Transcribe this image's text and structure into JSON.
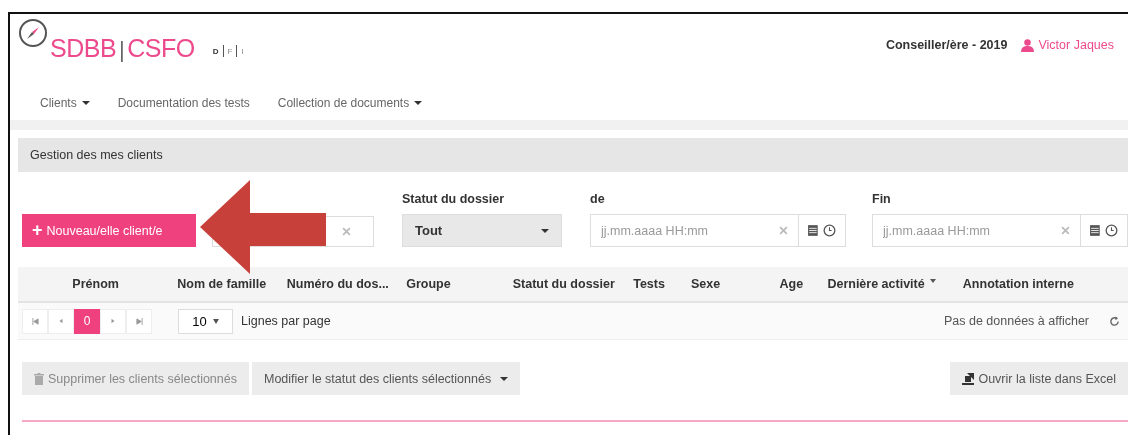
{
  "header": {
    "logo_left": "SDBB",
    "logo_separator": "|",
    "logo_right": "CSFO",
    "languages": [
      {
        "label": "D",
        "selected": true
      },
      {
        "label": "F",
        "selected": false
      },
      {
        "label": "I",
        "selected": false
      }
    ],
    "role": "Conseiller/ère - 2019",
    "user": "Victor Jaques"
  },
  "nav": [
    {
      "label": "Clients",
      "dropdown": true
    },
    {
      "label": "Documentation des tests",
      "dropdown": false
    },
    {
      "label": "Collection de documents",
      "dropdown": true
    }
  ],
  "section_title": "Gestion des mes clients",
  "new_button": {
    "icon": "+",
    "label": "Nouveau/elle client/e"
  },
  "filters": {
    "status_label": "Statut du dossier",
    "status_value": "Tout",
    "from_label": "de",
    "from_placeholder": "jj.mm.aaaa HH:mm",
    "to_label": "Fin",
    "to_placeholder": "jj.mm.aaaa HH:mm"
  },
  "table": {
    "columns": [
      {
        "label": "Prénom",
        "sorted": false
      },
      {
        "label": "Nom de famille",
        "sorted": false
      },
      {
        "label": "Numéro du dos...",
        "sorted": false
      },
      {
        "label": "Groupe",
        "sorted": false
      },
      {
        "label": "Statut du dossier",
        "sorted": false
      },
      {
        "label": "Tests",
        "sorted": false
      },
      {
        "label": "Sexe",
        "sorted": false
      },
      {
        "label": "Age",
        "sorted": false
      },
      {
        "label": "Dernière activité",
        "sorted": true
      },
      {
        "label": "Annotation interne",
        "sorted": false
      }
    ]
  },
  "pager": {
    "page": "0",
    "page_size": "10",
    "page_size_label": "Lignes par page",
    "empty_message": "Pas de données à afficher"
  },
  "actions": [
    {
      "label": "Supprimer les clients sélectionnés",
      "kind": "delete",
      "disabled": true
    },
    {
      "label": "Modifier le statut des clients sélectionnés",
      "kind": "dropdown",
      "disabled": false
    },
    {
      "label": "Ouvrir la liste dans Excel",
      "kind": "excel",
      "disabled": false
    }
  ]
}
